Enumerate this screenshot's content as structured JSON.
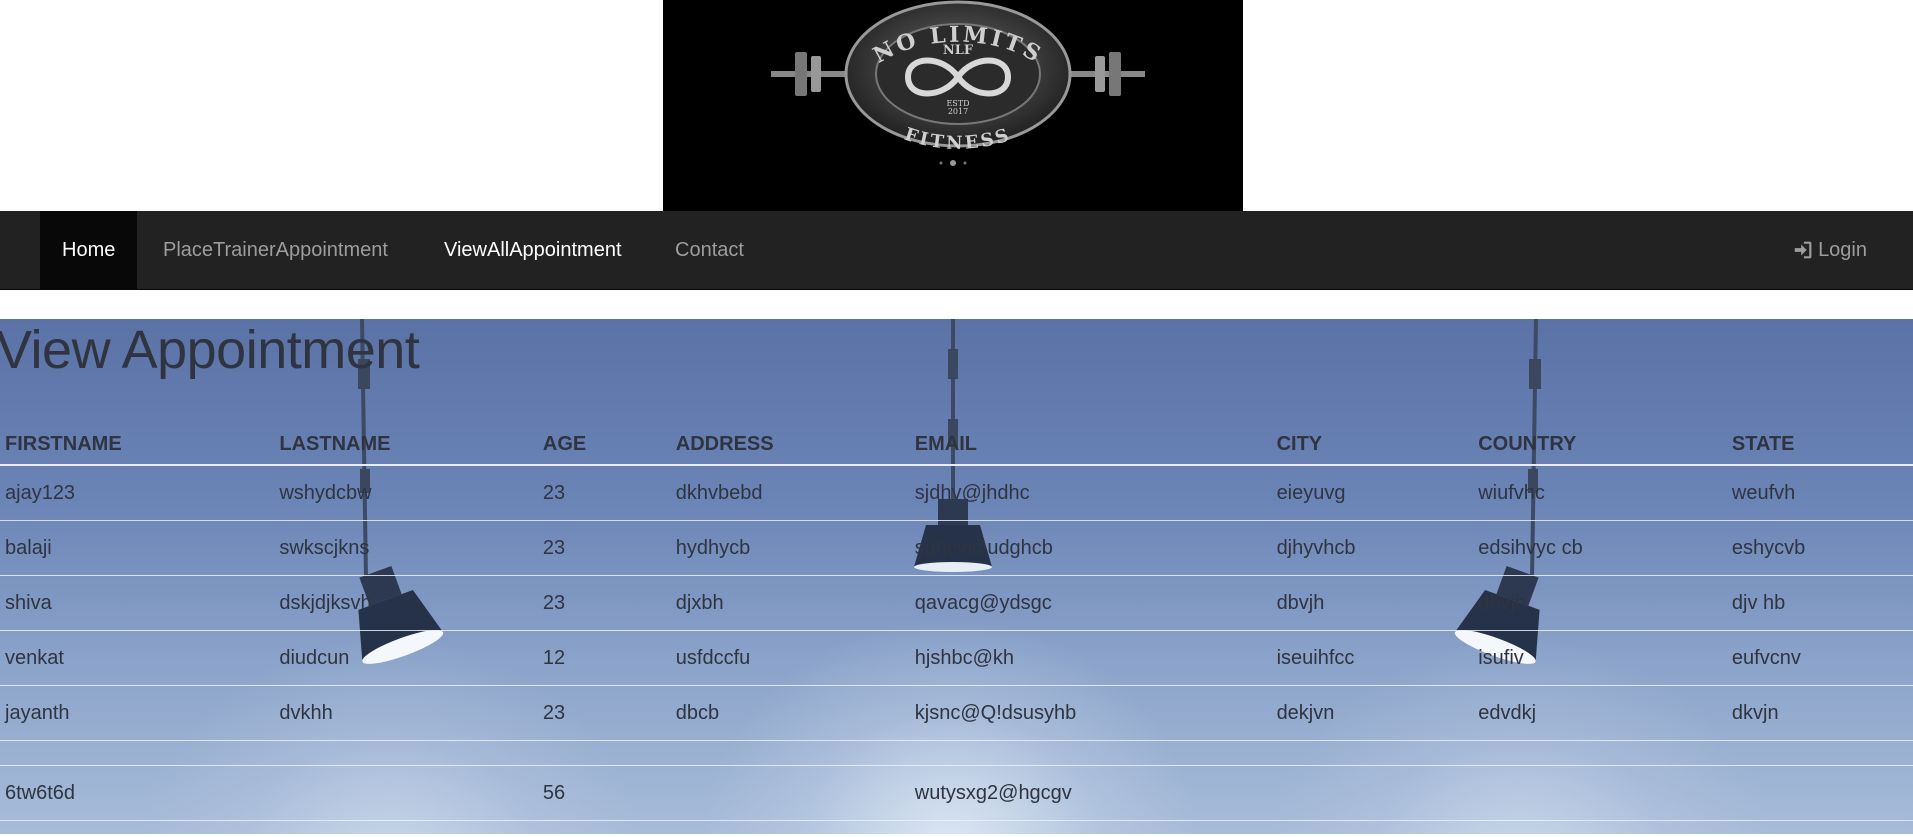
{
  "logo": {
    "top_text": "NO LIMITS",
    "bottom_text": "FITNESS",
    "monogram": "NLF",
    "estd": "ESTD",
    "year": "2017"
  },
  "navbar": {
    "items": [
      {
        "label": "Home"
      },
      {
        "label": "PlaceTrainerAppointment"
      },
      {
        "label": "ViewAllAppointment"
      },
      {
        "label": "Contact"
      }
    ],
    "login_label": "Login",
    "login_icon": "sign-in-icon"
  },
  "main": {
    "heading": "View Appointment",
    "table": {
      "headers": [
        "FIRSTNAME",
        "LASTNAME",
        "AGE",
        "ADDRESS",
        "EMAIL",
        "CITY",
        "COUNTRY",
        "STATE"
      ],
      "rows": [
        [
          "ajay123",
          "wshydcbw",
          "23",
          "dkhvbebd",
          "sjdhv@jhdhc",
          "eieyuvg",
          "wiufvhc",
          "weufvh"
        ],
        [
          "balaji",
          "swkscjkns",
          "23",
          "hydhycb",
          "sghcv@udghcb",
          "djhyvhcb",
          "edsihvyc cb",
          "eshycvb"
        ],
        [
          "shiva",
          "dskjdjksvh",
          "23",
          "djxbh",
          "qavacg@ydsgc",
          "dbvjh",
          "dbvjh",
          "djv hb"
        ],
        [
          "venkat",
          "diudcun",
          "12",
          "usfdccfu",
          "hjshbc@kh",
          "iseuihfcc",
          "isufiv",
          "eufvcnv"
        ],
        [
          "jayanth",
          "dvkhh",
          "23",
          "dbcb",
          "kjsnc@Q!dsusyhb",
          "dekjvn",
          "edvdkj",
          "dkvjn"
        ],
        [
          "",
          "",
          "",
          "",
          "",
          "",
          "",
          ""
        ],
        [
          "6tw6t6d",
          "",
          "56",
          "",
          "wutysxg2@hgcgv",
          "",
          "",
          ""
        ]
      ]
    }
  }
}
